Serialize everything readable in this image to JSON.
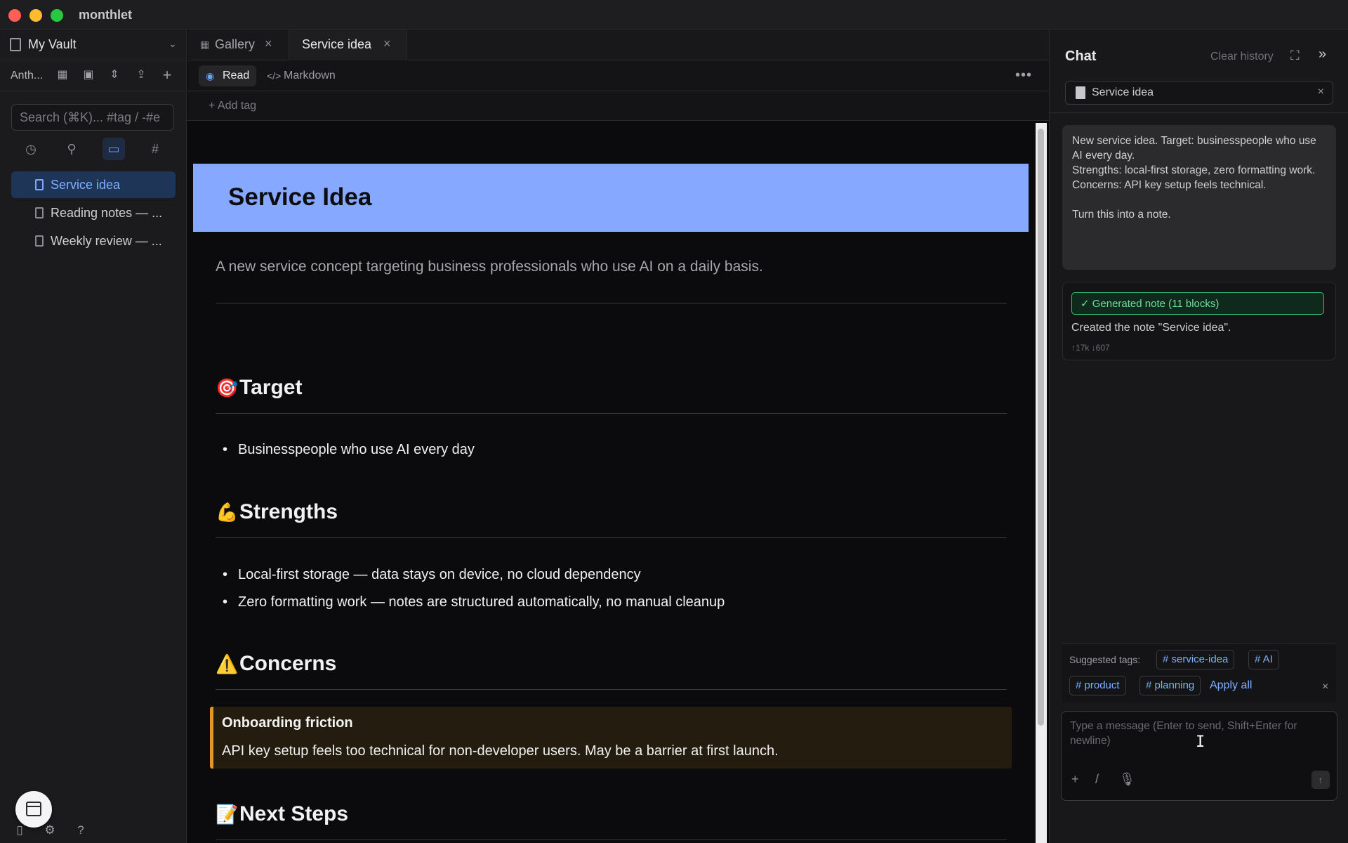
{
  "app": {
    "title": "monthlet"
  },
  "sidebar": {
    "vault_name": "My Vault",
    "toolbar_label": "Anth...",
    "search_placeholder": "Search (⌘K)... #tag / -#e",
    "files": [
      {
        "name": "Service idea",
        "active": true
      },
      {
        "name": "Reading notes — ..."
      },
      {
        "name": "Weekly review — ..."
      }
    ]
  },
  "tabs": [
    {
      "label": "Gallery"
    },
    {
      "label": "Service idea",
      "active": true
    }
  ],
  "modes": {
    "read": "Read",
    "markdown": "Markdown"
  },
  "tagbar": {
    "add_tag": "+ Add tag"
  },
  "document": {
    "title": "Service Idea",
    "subtitle": "A new service concept targeting business professionals who use AI on a daily basis.",
    "sections": {
      "target": {
        "emoji": "🎯",
        "heading": "Target",
        "bullets": [
          "Businesspeople who use AI every day"
        ]
      },
      "strengths": {
        "emoji": "💪",
        "heading": "Strengths",
        "bullets": [
          "Local-first storage — data stays on device, no cloud dependency",
          "Zero formatting work — notes are structured automatically, no manual cleanup"
        ]
      },
      "concerns": {
        "emoji": "⚠️",
        "heading": "Concerns",
        "callout_title": "Onboarding friction",
        "callout_body": "API key setup feels too technical for non-developer users. May be a barrier at first launch."
      },
      "next_steps": {
        "emoji": "📝",
        "heading": "Next Steps"
      }
    }
  },
  "chat": {
    "title": "Chat",
    "clear_history": "Clear history",
    "context_chip": "Service idea",
    "user_message": "New service idea. Target: businesspeople who use AI every day.\nStrengths: local-first storage, zero formatting work.\nConcerns: API key setup feels technical.\n\nTurn this into a note.",
    "assistant": {
      "badge": "✓  Generated note (11 blocks)",
      "text": "Created the note \"Service idea\".",
      "tokens": "↑17k ↓607"
    },
    "suggested_label": "Suggested tags:",
    "tags": [
      "# service-idea",
      "# AI",
      "# product",
      "# planning"
    ],
    "apply_all": "Apply all",
    "composer_placeholder": "Type a message (Enter to send, Shift+Enter for newline)"
  },
  "colors": {
    "accent": "#7eb0ff",
    "banner": "#86a8ff",
    "callout_border": "#e0962a",
    "success": "#2fbf71"
  }
}
